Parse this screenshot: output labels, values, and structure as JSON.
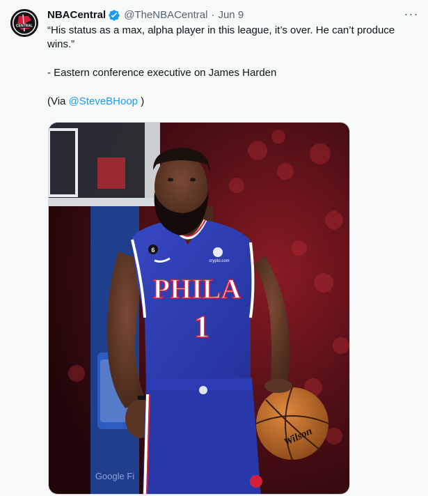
{
  "author": {
    "display_name": "NBACentral",
    "handle": "@TheNBACentral",
    "separator": "·",
    "date": "Jun 9",
    "avatar_text": "CENTRAL",
    "verified_color": "#1d9bf0"
  },
  "menu": {
    "more_label": "···"
  },
  "tweet": {
    "line1": "“His status as a max, alpha player in this league, it’s over. He can’t produce wins.”",
    "line2": "- Eastern conference executive on James Harden",
    "via_prefix": "(Via ",
    "via_mention": "@SteveBHoop",
    "via_suffix": " )"
  },
  "media": {
    "jersey_text": "PHILA",
    "jersey_number": "1",
    "patch_number": "6",
    "sponsor_text": "crypto.com",
    "ball_text": "Wilson",
    "courtside_text": "Google Fi",
    "colors": {
      "jersey": "#2f3fb0",
      "jersey_trim": "#ffffff",
      "jersey_red": "#d21f3c",
      "background": "#5a1018",
      "ball": "#c8702c"
    }
  }
}
